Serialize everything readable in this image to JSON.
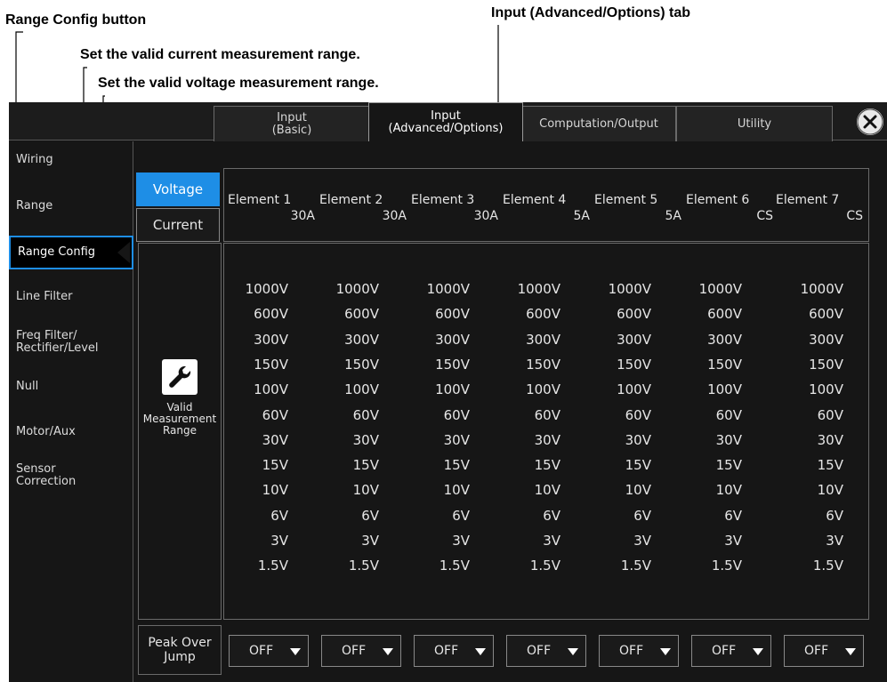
{
  "annotations": {
    "tab_callout": "Input (Advanced/Options) tab",
    "range_config_callout": "Range Config button",
    "current_callout": "Set the valid current measurement range.",
    "voltage_callout": "Set the valid voltage measurement range."
  },
  "tabs": [
    {
      "label": "Input\n(Basic)",
      "active": false
    },
    {
      "label": "Input\n(Advanced/Options)",
      "active": true
    },
    {
      "label": "Computation/Output",
      "active": false
    },
    {
      "label": "Utility",
      "active": false
    }
  ],
  "close_icon": "close-icon",
  "sidebar": {
    "items": [
      {
        "label": "Wiring"
      },
      {
        "label": "Range"
      },
      {
        "label": "Range Config",
        "active": true
      },
      {
        "label": "Line Filter"
      },
      {
        "label": "Freq Filter/\nRectifier/Level"
      },
      {
        "label": "Null"
      },
      {
        "label": "Motor/Aux"
      },
      {
        "label": "Sensor\nCorrection"
      }
    ]
  },
  "mode": {
    "voltage_label": "Voltage",
    "current_label": "Current",
    "selected": "Voltage"
  },
  "elements": [
    {
      "name": "Element 1",
      "range": "30A"
    },
    {
      "name": "Element 2",
      "range": "30A"
    },
    {
      "name": "Element 3",
      "range": "30A"
    },
    {
      "name": "Element 4",
      "range": "5A"
    },
    {
      "name": "Element 5",
      "range": "5A"
    },
    {
      "name": "Element 6",
      "range": "CS"
    },
    {
      "name": "Element 7",
      "range": "CS"
    }
  ],
  "valid_range": {
    "icon": "wrench-icon",
    "label": "Valid\nMeasurement\nRange"
  },
  "ranges": [
    "1000V",
    "600V",
    "300V",
    "150V",
    "100V",
    "60V",
    "30V",
    "15V",
    "10V",
    "6V",
    "3V",
    "1.5V"
  ],
  "peak_over_jump": {
    "label": "Peak Over\nJump",
    "values": [
      "OFF",
      "OFF",
      "OFF",
      "OFF",
      "OFF",
      "OFF",
      "OFF"
    ]
  },
  "colors": {
    "accent": "#1e8ee6",
    "background": "#161616",
    "text": "#e6e6e6"
  }
}
